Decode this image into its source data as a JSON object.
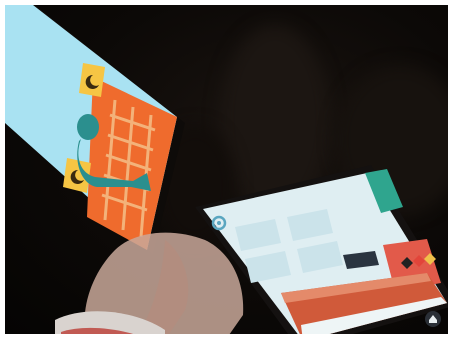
{
  "scene": {
    "description_free": true,
    "colors": {
      "background": "#0c0907",
      "left_screen_sky": "#a9e2f2",
      "left_screen_orange": "#ef6b2d",
      "left_screen_figure": "#2b8f8e",
      "left_screen_yellow": "#f6c544",
      "right_screen_wall": "#dfeef2",
      "right_screen_teal": "#2fa58e",
      "right_screen_floor": "#d05a3a",
      "skin": "#c9a89a",
      "sleeve_red": "#b8322a"
    },
    "icons": [
      "moon-icon",
      "gear-icon",
      "home-icon"
    ]
  }
}
